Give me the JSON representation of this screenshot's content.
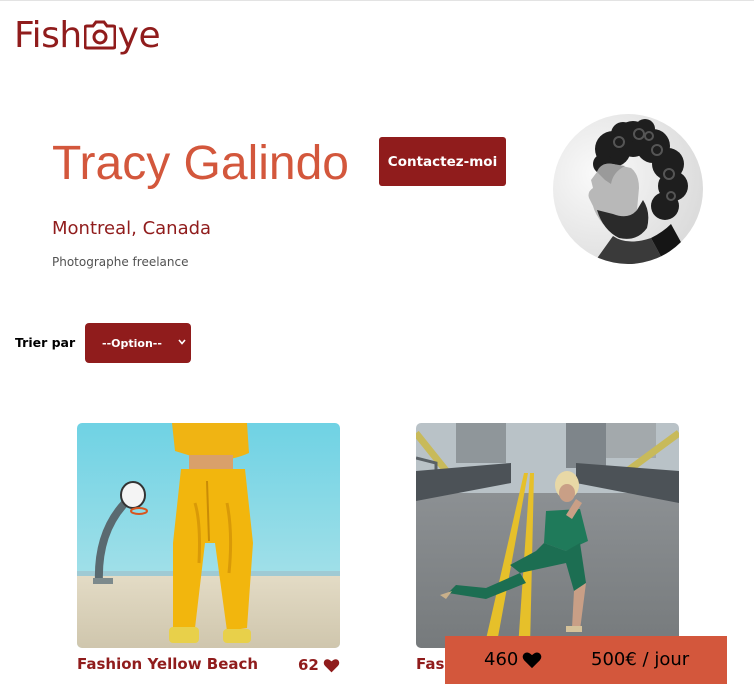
{
  "logo": {
    "text_before": "Fish",
    "text_after": "ye",
    "icon": "camera-icon"
  },
  "photographer": {
    "name": "Tracy Galindo",
    "location": "Montreal, Canada",
    "tagline": "Photographe freelance",
    "contact_label": "Contactez-moi",
    "avatar_icon": "portrait-photo"
  },
  "sort": {
    "label": "Trier par",
    "selected": "--Option--"
  },
  "media": [
    {
      "title": "Fashion Yellow Beach",
      "likes": "62",
      "image": "yellow-outfit-basketball-court-photo"
    },
    {
      "title": "Fas",
      "likes": "",
      "image": "woman-green-outfit-road-bridge-photo"
    }
  ],
  "stats": {
    "total_likes": "460",
    "price": "500€ / jour"
  },
  "colors": {
    "primary": "#901c1c",
    "secondary": "#d3573c",
    "muted": "#525252"
  }
}
